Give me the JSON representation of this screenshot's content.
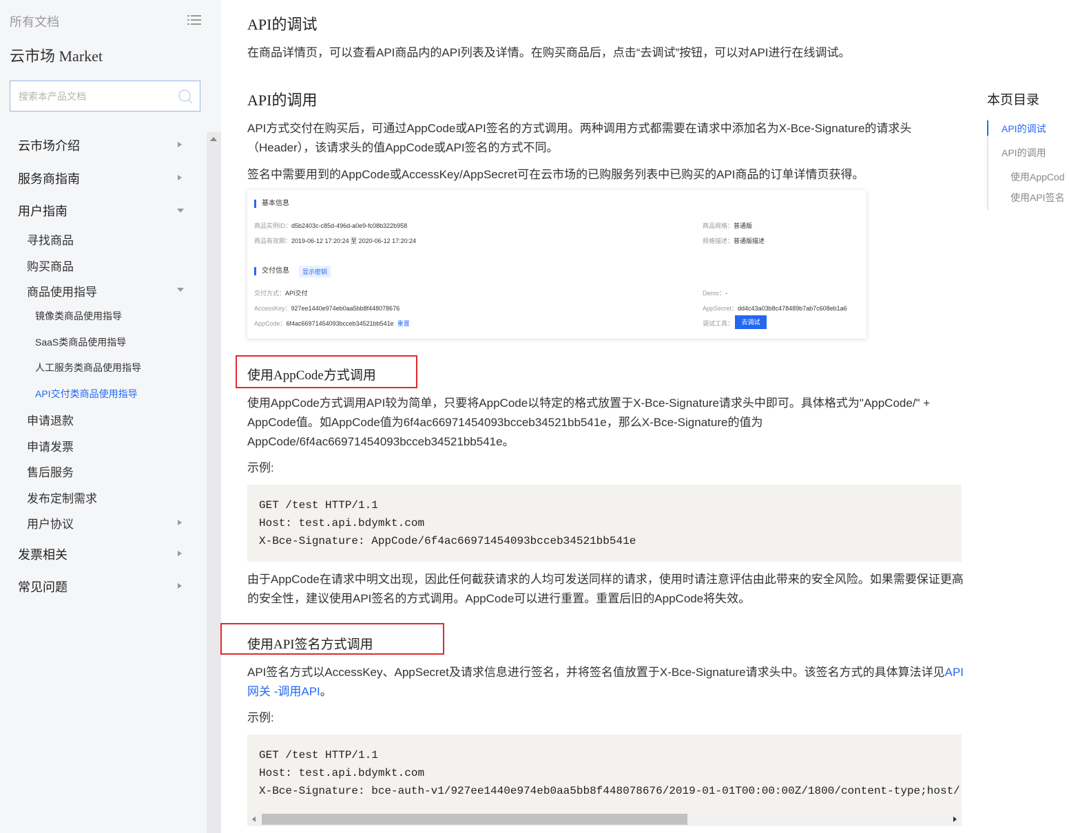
{
  "sidebar": {
    "all_docs": "所有文档",
    "product_title": "云市场 Market",
    "search_placeholder": "搜索本产品文档",
    "items": [
      {
        "label": "云市场介绍"
      },
      {
        "label": "服务商指南"
      },
      {
        "label": "用户指南"
      },
      {
        "label": "寻找商品"
      },
      {
        "label": "购买商品"
      },
      {
        "label": "商品使用指导"
      },
      {
        "label": "镜像类商品使用指导"
      },
      {
        "label": "SaaS类商品使用指导"
      },
      {
        "label": "人工服务类商品使用指导"
      },
      {
        "label": "API交付类商品使用指导"
      },
      {
        "label": "申请退款"
      },
      {
        "label": "申请发票"
      },
      {
        "label": "售后服务"
      },
      {
        "label": "发布定制需求"
      },
      {
        "label": "用户协议"
      },
      {
        "label": "发票相关"
      },
      {
        "label": "常见问题"
      }
    ]
  },
  "content": {
    "h_debug": "API的调试",
    "p_debug": "在商品详情页，可以查看API商品内的API列表及详情。在购买商品后，点击“去调试”按钮，可以对API进行在线调试。",
    "h_call": "API的调用",
    "p_call_1": "API方式交付在购买后，可通过AppCode或API签名的方式调用。两种调用方式都需要在请求中添加名为X-Bce-Signature的请求头（Header），该请求头的值AppCode或API签名的方式不同。",
    "p_call_2": "签名中需要用到的AppCode或AccessKey/AppSecret可在云市场的已购服务列表中已购买的API商品的订单详情页获得。",
    "screenshot": {
      "sec_basic": "基本信息",
      "instance_id_label": "商品实例ID：",
      "instance_id": "d5b2403c-c85d-496d-a0e9-fc08b322b958",
      "valid_label": "商品有效期：",
      "valid": "2019-06-12 17:20:24 至 2020-06-12 17:20:24",
      "spec_label": "商品规格：",
      "spec": "普通版",
      "spec_desc_label": "规格描述：",
      "spec_desc": "普通版描述",
      "sec_delivery": "交付信息",
      "show_key": "显示密钥",
      "delivery_label": "交付方式：",
      "delivery": "API交付",
      "ak_label": "AccessKey：",
      "ak": "927ee1440e974eb0aa5bb8f448078676",
      "appcode_label": "AppCode：",
      "appcode": "6f4ac66971454093bcceb34521bb541e",
      "reset": "重置",
      "demo_label": "Demo：",
      "demo": "-",
      "secret_label": "AppSecret：",
      "secret": "dd4c43a03b8c478489b7ab7c608eb1a6",
      "tool_label": "调试工具：",
      "debug_btn": "去调试"
    },
    "h_appcode": "使用AppCode方式调用",
    "p_appcode": "使用AppCode方式调用API较为简单，只要将AppCode以特定的格式放置于X-Bce-Signature请求头中即可。具体格式为\"AppCode/\" + AppCode值。如AppCode值为6f4ac66971454093bcceb34521bb541e，那么X-Bce-Signature的值为AppCode/6f4ac66971454093bcceb34521bb541e。",
    "example_label_1": "示例:",
    "code_1": "GET /test HTTP/1.1\nHost: test.api.bdymkt.com\nX-Bce-Signature: AppCode/6f4ac66971454093bcceb34521bb541e",
    "p_security": "由于AppCode在请求中明文出现，因此任何截获请求的人均可发送同样的请求，使用时请注意评估由此带来的安全风险。如果需要保证更高的安全性，建议使用API签名的方式调用。AppCode可以进行重置。重置后旧的AppCode将失效。",
    "h_sign": "使用API签名方式调用",
    "p_sign_pre": "API签名方式以AccessKey、AppSecret及请求信息进行签名，并将签名值放置于X-Bce-Signature请求头中。该签名方式的具体算法详见",
    "p_sign_link": "API网关 -调用API",
    "p_sign_post": "。",
    "example_label_2": "示例:",
    "code_2": "GET /test HTTP/1.1\nHost: test.api.bdymkt.com\nX-Bce-Signature: bce-auth-v1/927ee1440e974eb0aa5bb8f448078676/2019-01-01T00:00:00Z/1800/content-type;host/"
  },
  "toc": {
    "title": "本页目录",
    "items": [
      {
        "label": "API的调试"
      },
      {
        "label": "API的调用"
      },
      {
        "label": "使用AppCod"
      },
      {
        "label": "使用API签名"
      }
    ]
  },
  "colors": {
    "accent": "#2468f2",
    "highlight_box": "#e0282e"
  }
}
